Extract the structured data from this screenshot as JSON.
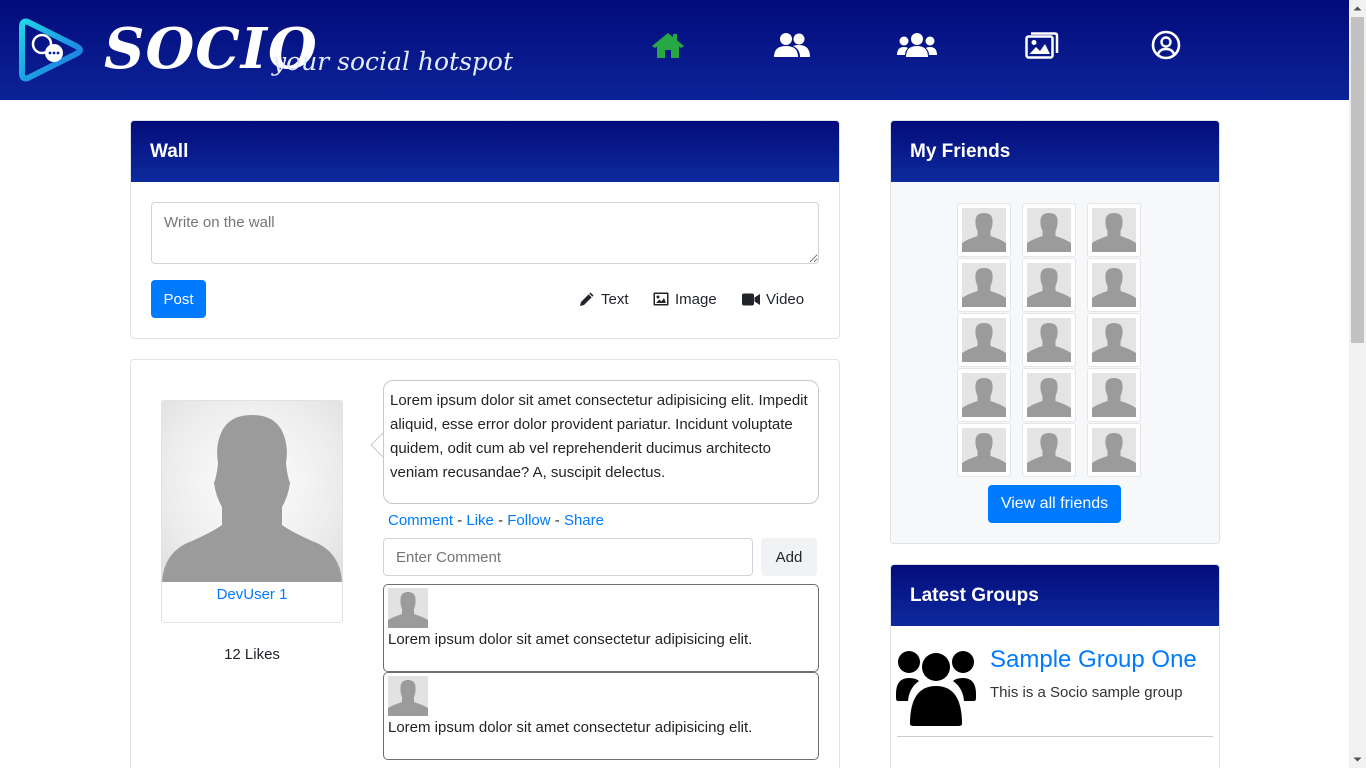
{
  "brand": {
    "name": "SOCIO",
    "tagline": "your social hotspot"
  },
  "nav": {
    "items": [
      {
        "icon": "home-icon",
        "active": true
      },
      {
        "icon": "friends-icon",
        "active": false
      },
      {
        "icon": "groups-icon",
        "active": false
      },
      {
        "icon": "photos-icon",
        "active": false
      },
      {
        "icon": "profile-icon",
        "active": false
      }
    ],
    "active_color": "#28a745"
  },
  "wall": {
    "title": "Wall",
    "textarea_placeholder": "Write on the wall",
    "post_button": "Post",
    "post_types": [
      {
        "icon": "pencil-icon",
        "label": "Text"
      },
      {
        "icon": "image-icon",
        "label": "Image"
      },
      {
        "icon": "video-icon",
        "label": "Video"
      }
    ]
  },
  "post": {
    "user": "DevUser 1",
    "likes": "12 Likes",
    "text": "Lorem ipsum dolor sit amet consectetur adipisicing elit. Impedit aliquid, esse error dolor provident pariatur. Incidunt voluptate quidem, odit cum ab vel reprehenderit ducimus architecto veniam recusandae? A, suscipit delectus.",
    "actions": {
      "comment": "Comment",
      "like": "Like",
      "follow": "Follow",
      "share": "Share",
      "separator": "-"
    },
    "comment_placeholder": "Enter Comment",
    "add_button": "Add",
    "comments": [
      {
        "text": "Lorem ipsum dolor sit amet consectetur adipisicing elit."
      },
      {
        "text": "Lorem ipsum dolor sit amet consectetur adipisicing elit."
      }
    ]
  },
  "friends": {
    "title": "My Friends",
    "count_shown": 15,
    "view_all_button": "View all friends"
  },
  "groups": {
    "title": "Latest Groups",
    "items": [
      {
        "name": "Sample Group One",
        "description": "This is a Socio sample group"
      }
    ]
  },
  "colors": {
    "primary": "#007bff",
    "header_dark": "#040c7a",
    "header_light": "#0d2a9e"
  }
}
